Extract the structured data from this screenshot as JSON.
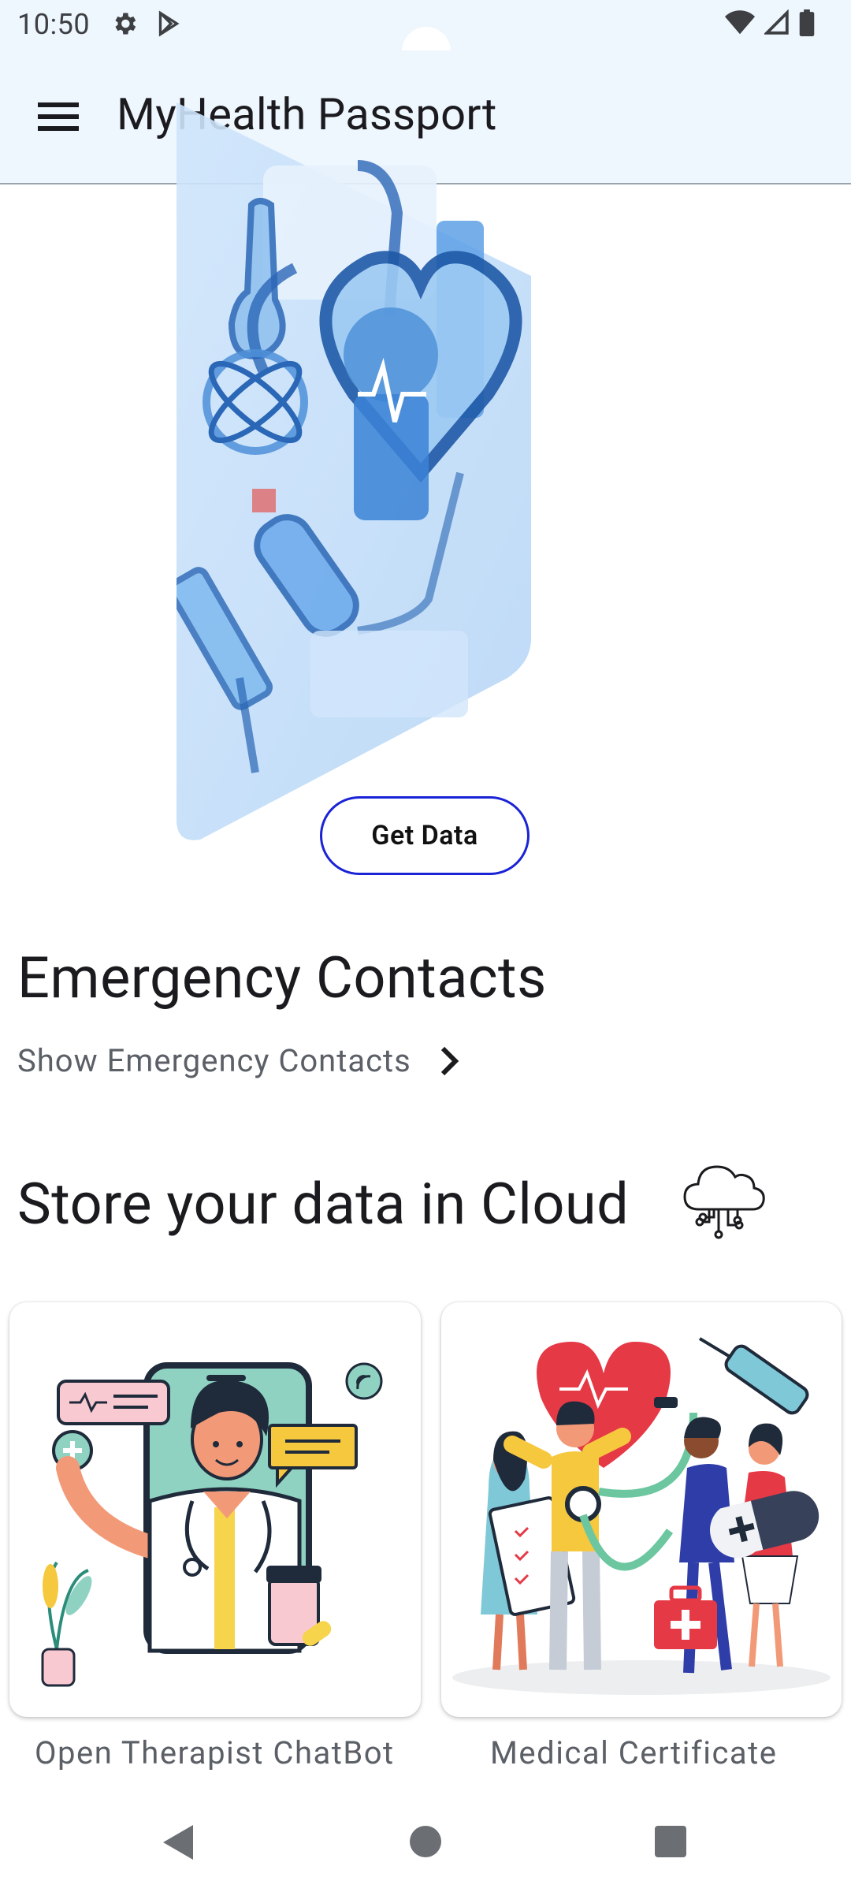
{
  "status_bar": {
    "time": "10:50"
  },
  "app_bar": {
    "title": "MyHealth Passport"
  },
  "hero": {
    "button_label": "Get Data"
  },
  "emergency": {
    "title": "Emergency Contacts",
    "link_label": "Show Emergency Contacts"
  },
  "cloud": {
    "title": "Store your data in Cloud"
  },
  "cards": [
    {
      "label": "Open Therapist ChatBot"
    },
    {
      "label": "Medical Certificate"
    }
  ],
  "colors": {
    "app_bar_bg": "#eef6fe",
    "button_border": "#1a23d6",
    "accent_blue": "#7ab8ef"
  },
  "icons": [
    "settings-icon",
    "play-store-icon",
    "wifi-icon",
    "signal-icon",
    "battery-icon",
    "menu-icon",
    "chevron-right-icon",
    "cloud-network-icon",
    "back-icon",
    "home-icon",
    "recents-icon"
  ]
}
